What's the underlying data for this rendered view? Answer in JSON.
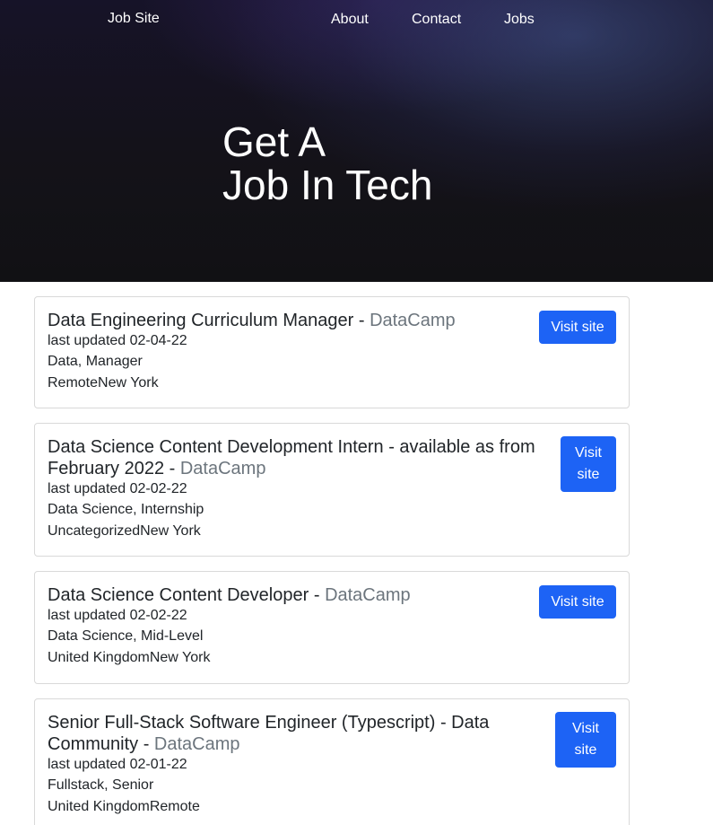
{
  "nav": {
    "brand": "Job Site",
    "links": [
      "About",
      "Contact",
      "Jobs"
    ]
  },
  "hero": {
    "title_line1": "Get A",
    "title_line2": "Job In Tech"
  },
  "jobs": [
    {
      "title": "Data Engineering Curriculum Manager",
      "separator": " - ",
      "company": "DataCamp",
      "updated": "last updated 02-04-22",
      "tags": "Data, Manager",
      "locations": "RemoteNew York",
      "button": "Visit site"
    },
    {
      "title": "Data Science Content Development Intern - available as from February 2022",
      "separator": " - ",
      "company": "DataCamp",
      "updated": "last updated 02-02-22",
      "tags": "Data Science, Internship",
      "locations": "UncategorizedNew York",
      "button": "Visit site"
    },
    {
      "title": "Data Science Content Developer",
      "separator": " - ",
      "company": "DataCamp",
      "updated": "last updated 02-02-22",
      "tags": "Data Science, Mid-Level",
      "locations": "United KingdomNew York",
      "button": "Visit site"
    },
    {
      "title": "Senior Full-Stack Software Engineer (Typescript) - Data Community",
      "separator": " - ",
      "company": "DataCamp",
      "updated": "last updated 02-01-22",
      "tags": "Fullstack, Senior",
      "locations": "United KingdomRemote",
      "button": "Visit site"
    }
  ],
  "colors": {
    "button_bg": "#1d63f5",
    "company_text": "#6c757d",
    "hero_bg": "#121117"
  }
}
